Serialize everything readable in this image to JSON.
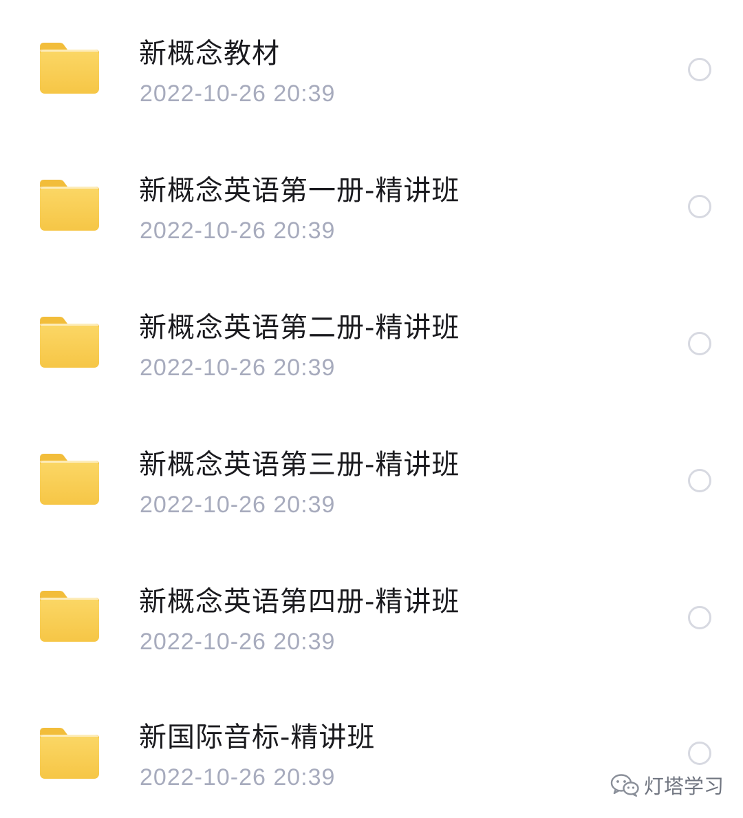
{
  "files": [
    {
      "name": "新概念教材",
      "modified": "2022-10-26 20:39",
      "icon": "folder-icon",
      "selected": false
    },
    {
      "name": "新概念英语第一册-精讲班",
      "modified": "2022-10-26 20:39",
      "icon": "folder-icon",
      "selected": false
    },
    {
      "name": "新概念英语第二册-精讲班",
      "modified": "2022-10-26 20:39",
      "icon": "folder-icon",
      "selected": false
    },
    {
      "name": "新概念英语第三册-精讲班",
      "modified": "2022-10-26 20:39",
      "icon": "folder-icon",
      "selected": false
    },
    {
      "name": "新概念英语第四册-精讲班",
      "modified": "2022-10-26 20:39",
      "icon": "folder-icon",
      "selected": false
    },
    {
      "name": "新国际音标-精讲班",
      "modified": "2022-10-26 20:39",
      "icon": "folder-icon",
      "selected": false
    }
  ],
  "watermark": {
    "text": "灯塔学习",
    "icon": "wechat-icon"
  },
  "colors": {
    "folder_body": "#f7c94b",
    "folder_tab": "#f2bd3a",
    "name_text": "#1b1b1f",
    "date_text": "#a7abbd",
    "circle_border": "#d7d9e1"
  }
}
